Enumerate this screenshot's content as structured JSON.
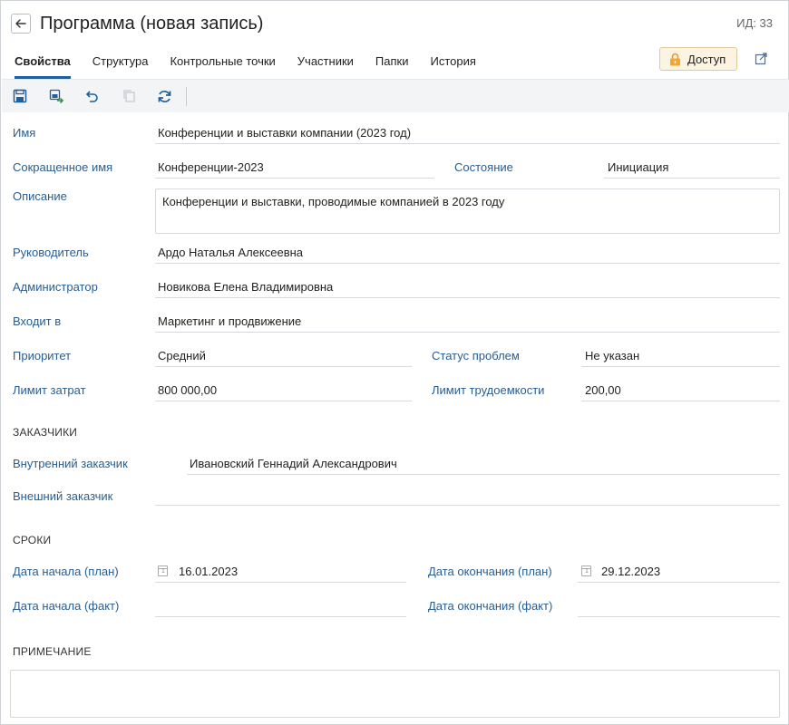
{
  "header": {
    "title": "Программа (новая запись)",
    "id_text": "ИД: 33"
  },
  "tabs": [
    {
      "label": "Свойства",
      "active": true
    },
    {
      "label": "Структура"
    },
    {
      "label": "Контрольные точки"
    },
    {
      "label": "Участники"
    },
    {
      "label": "Папки"
    },
    {
      "label": "История"
    }
  ],
  "access_button": "Доступ",
  "toolbar": {
    "icons": [
      "save-icon",
      "save-and-close-icon",
      "undo-icon",
      "copy-icon",
      "refresh-icon"
    ]
  },
  "form": {
    "name": {
      "label": "Имя",
      "value": "Конференции и выставки компании (2023 год)"
    },
    "short_name": {
      "label": "Сокращенное имя",
      "value": "Конференции-2023"
    },
    "state": {
      "label": "Состояние",
      "value": "Инициация"
    },
    "description": {
      "label": "Описание",
      "value": "Конференции и выставки, проводимые компанией в 2023 году"
    },
    "manager": {
      "label": "Руководитель",
      "value": "Ардо Наталья Алексеевна"
    },
    "administrator": {
      "label": "Администратор",
      "value": "Новикова Елена Владимировна"
    },
    "parent": {
      "label": "Входит в",
      "value": "Маркетинг и продвижение"
    },
    "priority": {
      "label": "Приоритет",
      "value": "Средний"
    },
    "issue_status": {
      "label": "Статус проблем",
      "value": "Не указан"
    },
    "cost_limit": {
      "label": "Лимит затрат",
      "value": "800 000,00"
    },
    "labor_limit": {
      "label": "Лимит трудоемкости",
      "value": "200,00"
    }
  },
  "customers": {
    "section_title": "Заказчики",
    "internal": {
      "label": "Внутренний заказчик",
      "value": "Ивановский Геннадий Александрович"
    },
    "external": {
      "label": "Внешний заказчик",
      "value": ""
    }
  },
  "dates": {
    "section_title": "Сроки",
    "start_plan": {
      "label": "Дата начала (план)",
      "value": "16.01.2023"
    },
    "end_plan": {
      "label": "Дата окончания (план)",
      "value": "29.12.2023"
    },
    "start_fact": {
      "label": "Дата начала (факт)",
      "value": ""
    },
    "end_fact": {
      "label": "Дата окончания (факт)",
      "value": ""
    }
  },
  "note": {
    "section_title": "Примечание",
    "value": ""
  },
  "colors": {
    "label": "#2a5d8f",
    "tab_underline": "#1f5f9e",
    "access_bg": "#fdf3e3",
    "toolbar_bg": "#f3f4f6"
  }
}
